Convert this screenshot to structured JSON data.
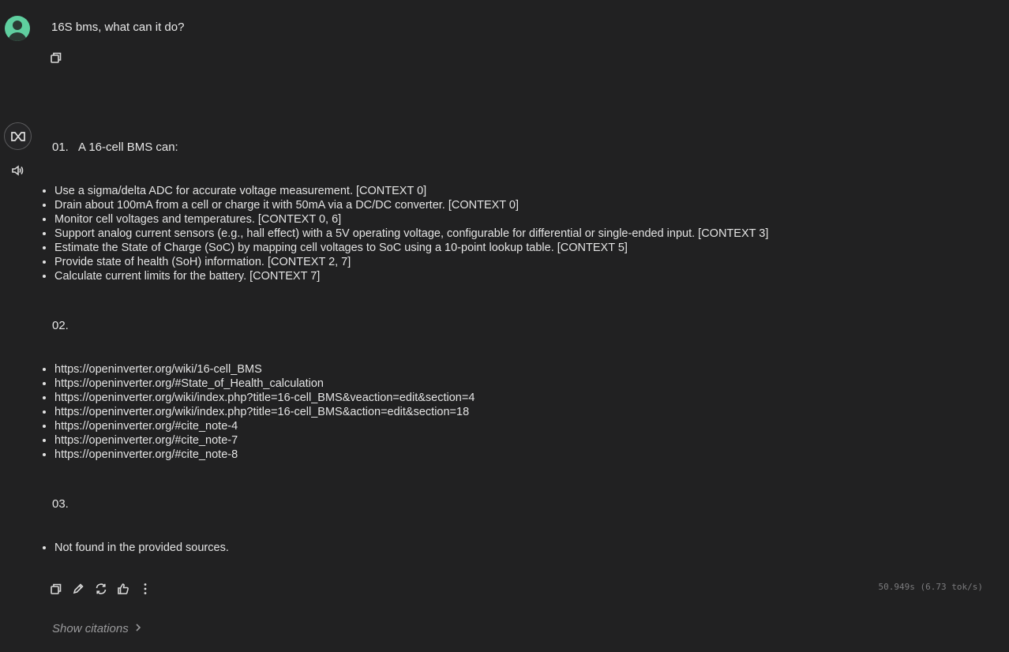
{
  "user": {
    "message": "16S bms, what can it do?"
  },
  "response": {
    "sections": [
      {
        "number": "01.",
        "title": "A 16-cell BMS can:",
        "items": [
          "Use a sigma/delta ADC for accurate voltage measurement. [CONTEXT 0]",
          "Drain about 100mA from a cell or charge it with 50mA via a DC/DC converter. [CONTEXT 0]",
          "Monitor cell voltages and temperatures. [CONTEXT 0, 6]",
          "Support analog current sensors (e.g., hall effect) with a 5V operating voltage, configurable for differential or single-ended input. [CONTEXT 3]",
          "Estimate the State of Charge (SoC) by mapping cell voltages to SoC using a 10-point lookup table. [CONTEXT 5]",
          "Provide state of health (SoH) information. [CONTEXT 2, 7]",
          "Calculate current limits for the battery. [CONTEXT 7]"
        ]
      },
      {
        "number": "02.",
        "title": "",
        "items": [
          "https://openinverter.org/wiki/16-cell_BMS",
          "https://openinverter.org/#State_of_Health_calculation",
          "https://openinverter.org/wiki/index.php?title=16-cell_BMS&veaction=edit&section=4",
          "https://openinverter.org/wiki/index.php?title=16-cell_BMS&action=edit&section=18",
          "https://openinverter.org/#cite_note-4",
          "https://openinverter.org/#cite_note-7",
          "https://openinverter.org/#cite_note-8"
        ]
      },
      {
        "number": "03.",
        "title": "",
        "items": [
          "Not found in the provided sources."
        ]
      }
    ],
    "stats": "50.949s (6.73 tok/s)",
    "show_citations_label": "Show citations"
  },
  "icons": {
    "user_copy": "copy-icon",
    "ai_logo": "model-logo-icon",
    "speak": "speaker-icon",
    "copy": "copy-icon",
    "edit": "pencil-icon",
    "regenerate": "refresh-icon",
    "like": "thumbs-up-icon",
    "more": "more-vertical-icon",
    "chevron": "chevron-right-icon"
  }
}
